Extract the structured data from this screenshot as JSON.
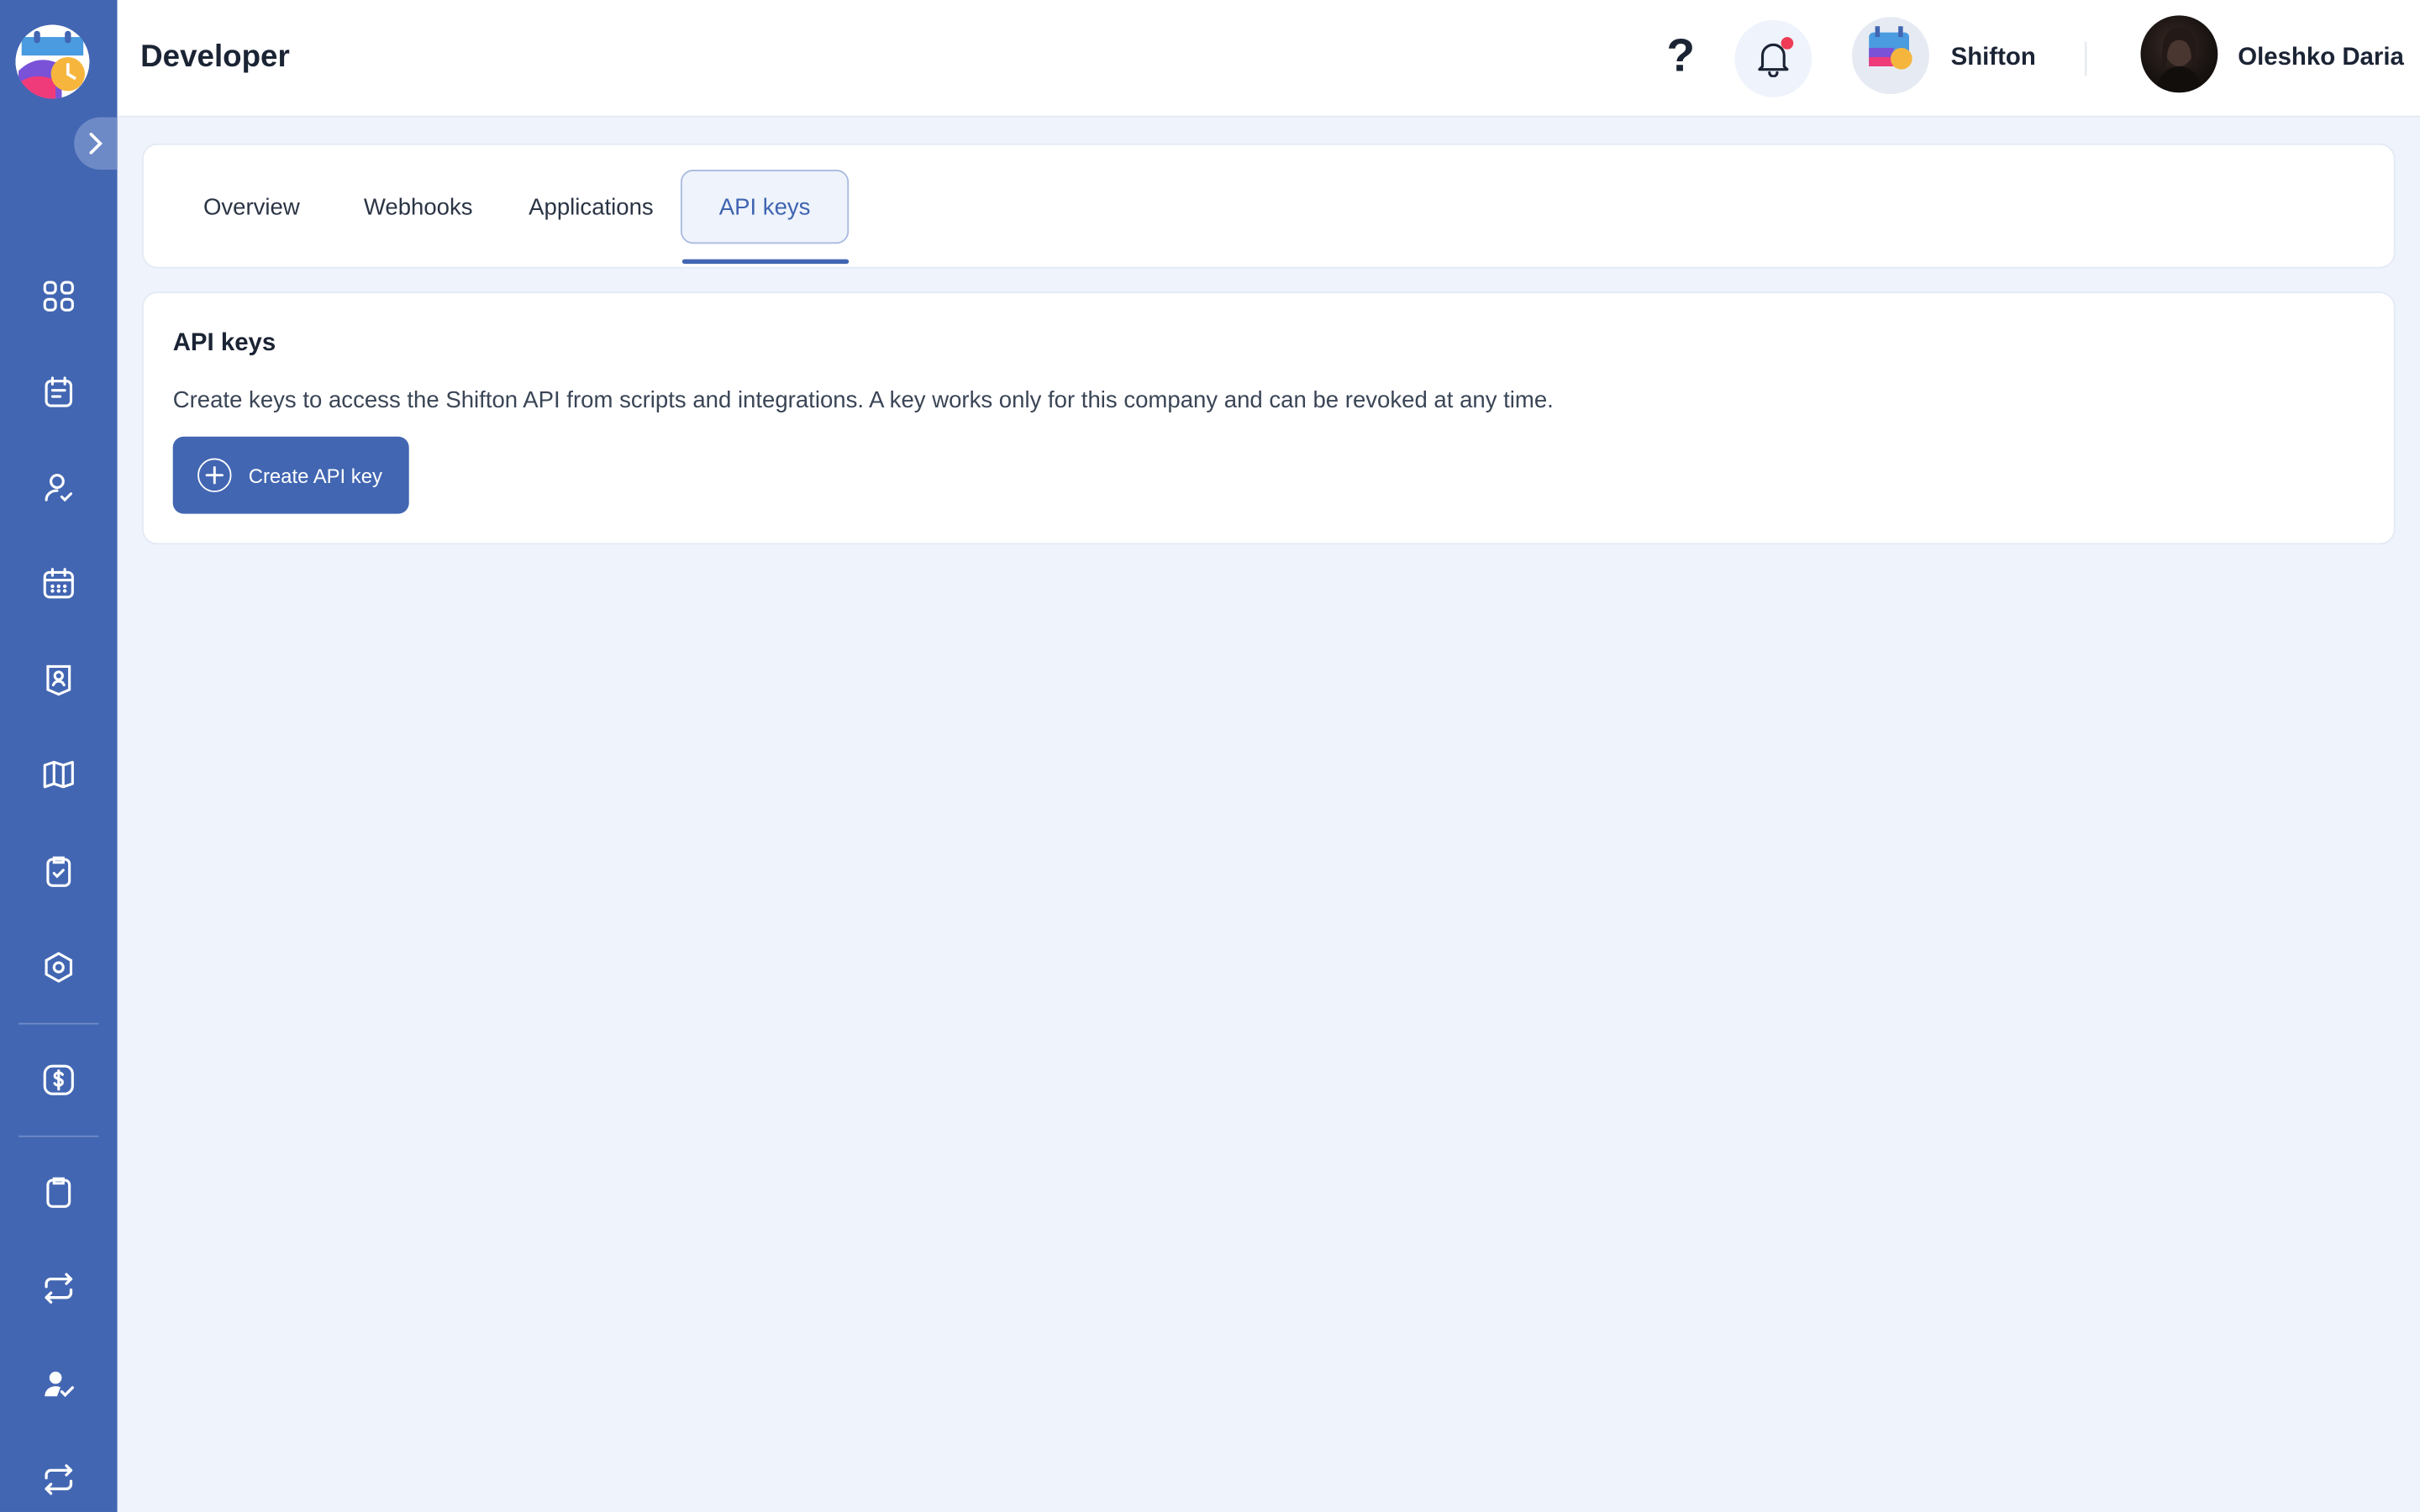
{
  "app": {
    "page_title": "Developer",
    "help_glyph": "?",
    "company_name": "Shifton",
    "user_name": "Oleshko Daria",
    "colors": {
      "sidebar": "#4266b2",
      "accent": "#4266b2",
      "background": "#eef3fc",
      "notification_dot": "#ef3b55"
    }
  },
  "sidebar": {
    "items": [
      {
        "icon": "dashboard-grid-icon"
      },
      {
        "icon": "schedule-list-icon"
      },
      {
        "icon": "user-check-icon"
      },
      {
        "icon": "calendar-icon"
      },
      {
        "icon": "badge-icon"
      },
      {
        "icon": "map-icon"
      },
      {
        "icon": "clipboard-check-icon"
      },
      {
        "icon": "settings-hexagon-icon"
      },
      {
        "icon": "dollar-icon"
      },
      {
        "icon": "clipboard-icon"
      },
      {
        "icon": "repeat-icon"
      },
      {
        "icon": "user-verified-icon"
      },
      {
        "icon": "repeat-icon"
      }
    ]
  },
  "tabs": [
    {
      "label": "Overview",
      "active": false
    },
    {
      "label": "Webhooks",
      "active": false
    },
    {
      "label": "Applications",
      "active": false
    },
    {
      "label": "API keys",
      "active": true
    }
  ],
  "api_keys": {
    "title": "API keys",
    "description": "Create keys to access the Shifton API from scripts and integrations. A key works only for this company and can be revoked at any time.",
    "create_button_label": "Create API key"
  }
}
